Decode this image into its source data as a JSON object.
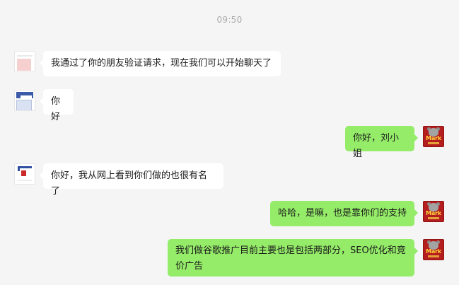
{
  "chat": {
    "timestamp": "09:50",
    "messages": [
      {
        "side": "left",
        "text": "我通过了你的朋友验证请求，现在我们可以开始聊天了"
      },
      {
        "side": "left",
        "text": "你好"
      },
      {
        "side": "right",
        "text": "你好，刘小姐"
      },
      {
        "side": "left",
        "text": "你好，我从网上看到你们做的也很有名了"
      },
      {
        "side": "right",
        "text": "哈哈，是嘛，也是靠你们的支持"
      },
      {
        "side": "right",
        "text": "我们做谷歌推广目前主要也是包括两部分，SEO优化和竞价广告"
      }
    ],
    "self_avatar_brand": "Mark"
  },
  "colors": {
    "background": "#f5f5f5",
    "incoming_bubble": "#ffffff",
    "outgoing_bubble": "#95ec69",
    "timestamp_text": "#a8a8a8"
  },
  "icons": {
    "contact_avatar": "contact-avatar",
    "self_avatar": "mark-logo-avatar"
  }
}
